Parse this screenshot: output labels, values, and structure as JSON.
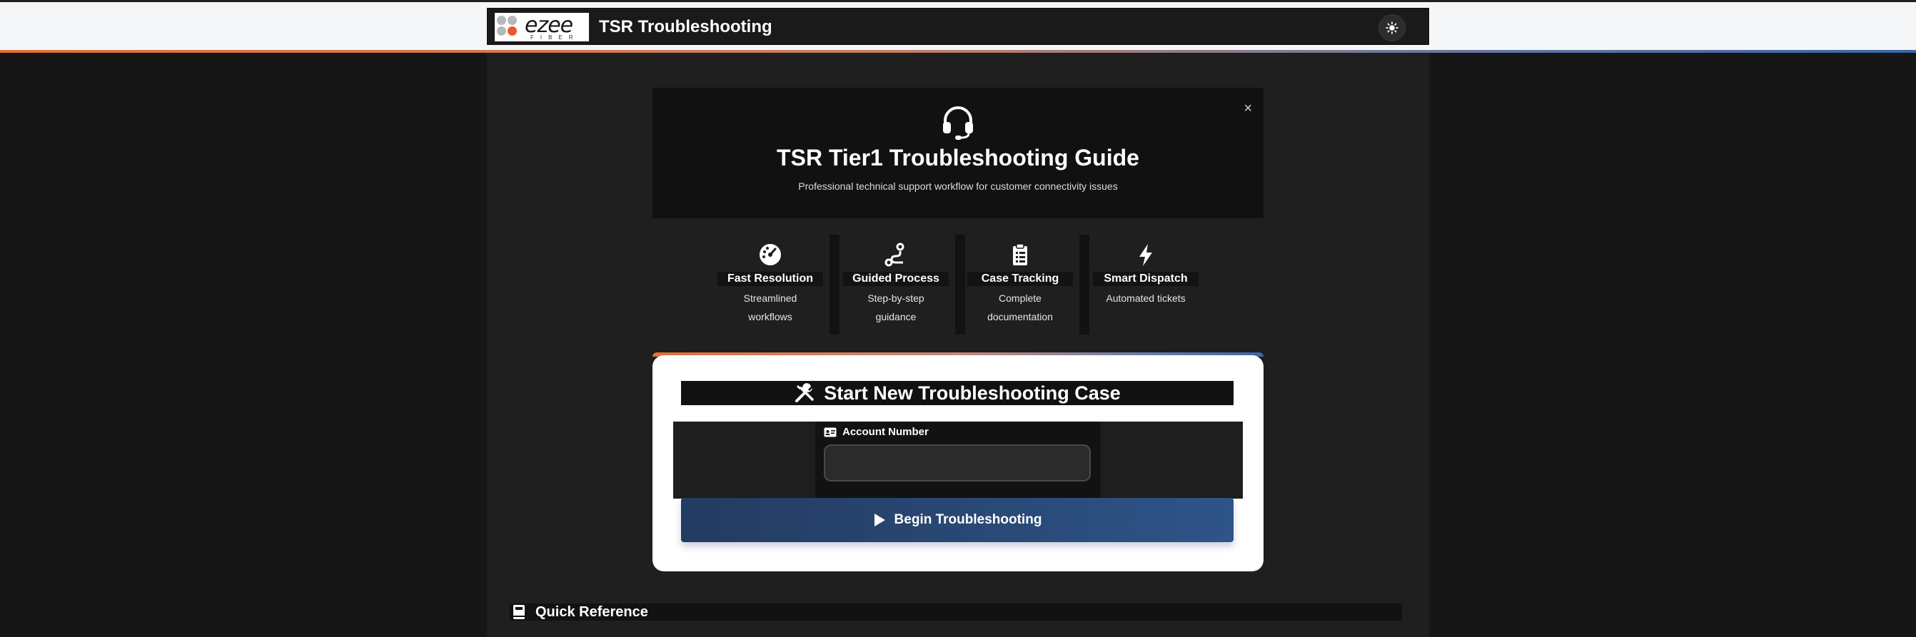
{
  "header": {
    "title": "TSR Troubleshooting",
    "logo_text": "ezee",
    "logo_subtext": "FIBER",
    "theme_toggle_icon": "sun-icon"
  },
  "hero": {
    "icon": "headset-icon",
    "title": "TSR Tier1 Troubleshooting Guide",
    "subtitle": "Professional technical support workflow for customer connectivity issues",
    "close_label": "×"
  },
  "features": [
    {
      "icon": "gauge-icon",
      "title": "Fast Resolution",
      "desc": "Streamlined workflows"
    },
    {
      "icon": "route-icon",
      "title": "Guided Process",
      "desc": "Step-by-step guidance"
    },
    {
      "icon": "clipboard-icon",
      "title": "Case Tracking",
      "desc": "Complete documentation"
    },
    {
      "icon": "bolt-icon",
      "title": "Smart Dispatch",
      "desc": "Automated tickets"
    }
  ],
  "case_form": {
    "title": "Start New Troubleshooting Case",
    "title_icon": "tools-icon",
    "account_label": "Account Number",
    "account_label_icon": "id-card-icon",
    "account_value": "",
    "account_placeholder": "",
    "begin_label": "Begin Troubleshooting",
    "begin_icon": "play-icon"
  },
  "quick_reference": {
    "label": "Quick Reference",
    "icon": "book-icon"
  },
  "colors": {
    "accent_orange": "#e0703a",
    "accent_blue": "#2e5488",
    "page_bg": "#161616"
  }
}
